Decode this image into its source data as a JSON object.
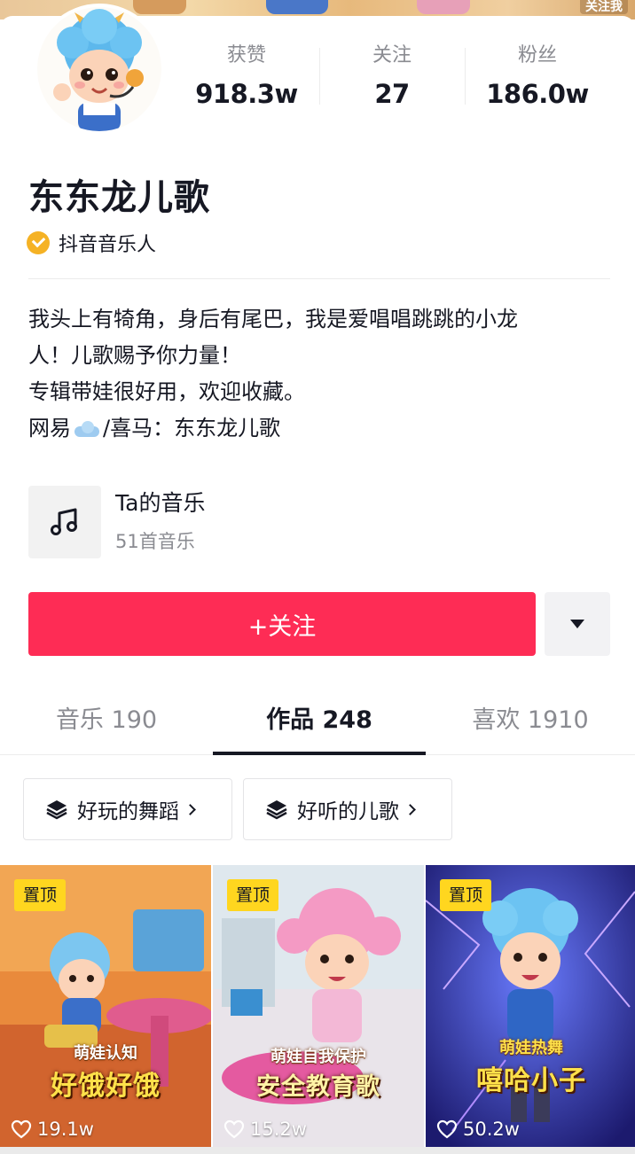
{
  "banner": {
    "follow_me": "关注我"
  },
  "profile": {
    "name": "东东龙儿歌",
    "verified_label": "抖音音乐人"
  },
  "stats": [
    {
      "label": "获赞",
      "value": "918.3w"
    },
    {
      "label": "关注",
      "value": "27"
    },
    {
      "label": "粉丝",
      "value": "186.0w"
    }
  ],
  "bio": {
    "line1": "我头上有犄角，身后有尾巴，我是爱唱唱跳跳的小龙",
    "line2": "人！儿歌赐予你力量！",
    "line3": "专辑带娃很好用，欢迎收藏。",
    "line4_a": "网易",
    "line4_b": "/喜马：东东龙儿歌"
  },
  "music": {
    "title": "Ta的音乐",
    "subtitle": "51首音乐"
  },
  "actions": {
    "follow_label": "+关注"
  },
  "tabs": [
    {
      "label": "音乐 190"
    },
    {
      "label": "作品 248",
      "active": true
    },
    {
      "label": "喜欢 1910"
    }
  ],
  "collections": [
    {
      "label": "好玩的舞蹈"
    },
    {
      "label": "好听的儿歌"
    }
  ],
  "videos": [
    {
      "pin": "置顶",
      "title_small": "萌娃认知",
      "title_big": "好饿好饿",
      "likes": "19.1w"
    },
    {
      "pin": "置顶",
      "title_small": "萌娃自我保护",
      "title_big": "安全教育歌",
      "likes": "15.2w"
    },
    {
      "pin": "置顶",
      "title_small": "萌娃热舞",
      "title_big": "嘻哈小子",
      "likes": "50.2w"
    }
  ],
  "colors": {
    "accent": "#fe2c55",
    "pin": "#ffd61f",
    "verified": "#f5b225"
  }
}
